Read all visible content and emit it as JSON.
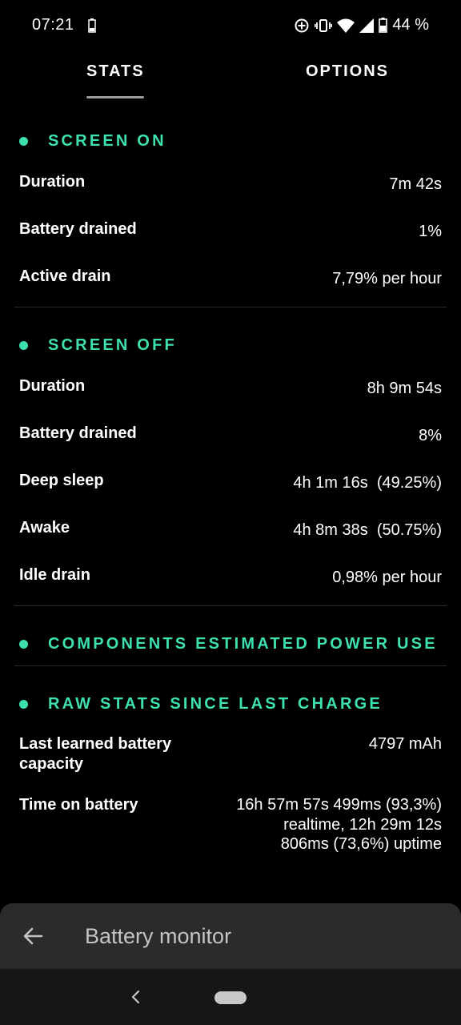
{
  "status_bar": {
    "time": "07:21",
    "battery_percent": "44 %",
    "icons": [
      "battery-small-icon",
      "data-saver-icon",
      "vibrate-icon",
      "wifi-icon",
      "cell-signal-icon",
      "battery-icon"
    ]
  },
  "tabs": [
    {
      "label": "STATS",
      "active": true
    },
    {
      "label": "OPTIONS",
      "active": false
    }
  ],
  "sections": {
    "screen_on": {
      "title": "SCREEN ON",
      "rows": [
        {
          "label": "Duration",
          "value": "7m 42s"
        },
        {
          "label": "Battery drained",
          "value": "1%"
        },
        {
          "label": "Active drain",
          "value": "7,79% per hour"
        }
      ]
    },
    "screen_off": {
      "title": "SCREEN OFF",
      "rows": [
        {
          "label": "Duration",
          "value": "8h 9m 54s"
        },
        {
          "label": "Battery drained",
          "value": "8%"
        },
        {
          "label": "Deep sleep",
          "value": "4h 1m 16s  (49.25%)"
        },
        {
          "label": "Awake",
          "value": "4h 8m 38s  (50.75%)"
        },
        {
          "label": "Idle drain",
          "value": "0,98% per hour"
        }
      ]
    },
    "components": {
      "title": "COMPONENTS ESTIMATED POWER USE"
    },
    "raw_stats": {
      "title": "RAW STATS SINCE LAST CHARGE",
      "rows": [
        {
          "label": "Last learned battery capacity",
          "value": "4797 mAh"
        },
        {
          "label": "Time on battery",
          "value": "16h 57m 57s 499ms (93,3%) realtime, 12h 29m 12s 806ms (73,6%) uptime"
        }
      ]
    }
  },
  "snackbar": {
    "title": "Battery monitor",
    "back_icon": "arrow-back-icon"
  },
  "colors": {
    "accent": "#3ee0b0",
    "background": "#000000",
    "snackbar": "#2b2b2b",
    "divider": "#2a2a2a"
  }
}
